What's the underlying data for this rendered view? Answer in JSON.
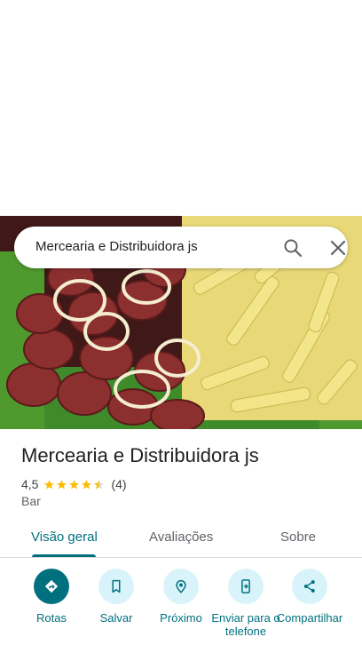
{
  "search": {
    "query": "Mercearia e Distribuidora js"
  },
  "place": {
    "name": "Mercearia e Distribuidora js",
    "rating": "4,5",
    "rating_stars": 4.5,
    "review_count": "(4)",
    "category": "Bar"
  },
  "tabs": [
    {
      "label": "Visão geral",
      "active": true
    },
    {
      "label": "Avaliações",
      "active": false
    },
    {
      "label": "Sobre",
      "active": false
    }
  ],
  "actions": [
    {
      "label": "Rotas",
      "icon": "directions-icon"
    },
    {
      "label": "Salvar",
      "icon": "bookmark-icon"
    },
    {
      "label": "Próximo",
      "icon": "nearby-icon"
    },
    {
      "label": "Enviar para o telefone",
      "icon": "send-to-phone-icon"
    },
    {
      "label": "Compartilhar",
      "icon": "share-icon"
    }
  ],
  "colors": {
    "accent": "#00707f",
    "action_bg": "#d8f4fa",
    "star": "#fbbc04"
  }
}
